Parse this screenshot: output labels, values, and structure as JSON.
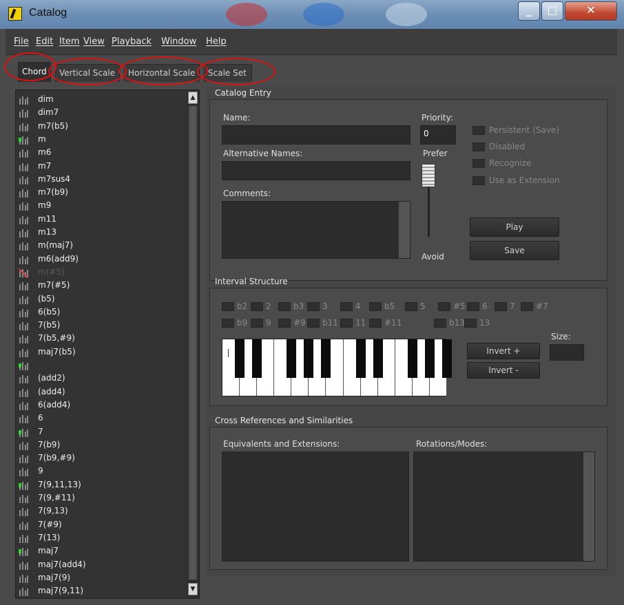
{
  "window": {
    "title": "Catalog"
  },
  "menu": [
    {
      "label": "File"
    },
    {
      "label": "Edit"
    },
    {
      "label": "Item"
    },
    {
      "label": "View"
    },
    {
      "label": "Playback"
    },
    {
      "label": "Window"
    },
    {
      "label": "Help"
    }
  ],
  "tabs": [
    {
      "label": "Chord",
      "active": true
    },
    {
      "label": "Vertical Scale",
      "active": false
    },
    {
      "label": "Horizontal Scale",
      "active": false
    },
    {
      "label": "Scale Set",
      "active": false
    }
  ],
  "chord_list": [
    {
      "label": "dim",
      "marker": false,
      "disabled": false
    },
    {
      "label": "dim7",
      "marker": false,
      "disabled": false
    },
    {
      "label": "m7(b5)",
      "marker": false,
      "disabled": false
    },
    {
      "label": "m",
      "marker": true,
      "disabled": false
    },
    {
      "label": "m6",
      "marker": false,
      "disabled": false
    },
    {
      "label": "m7",
      "marker": false,
      "disabled": false
    },
    {
      "label": "m7sus4",
      "marker": false,
      "disabled": false
    },
    {
      "label": "m7(b9)",
      "marker": false,
      "disabled": false
    },
    {
      "label": "m9",
      "marker": false,
      "disabled": false
    },
    {
      "label": "m11",
      "marker": false,
      "disabled": false
    },
    {
      "label": "m13",
      "marker": false,
      "disabled": false
    },
    {
      "label": "m(maj7)",
      "marker": false,
      "disabled": false
    },
    {
      "label": "m6(add9)",
      "marker": false,
      "disabled": false
    },
    {
      "label": "m(#5)",
      "marker": false,
      "disabled": true
    },
    {
      "label": "m7(#5)",
      "marker": false,
      "disabled": false
    },
    {
      "label": "(b5)",
      "marker": false,
      "disabled": false
    },
    {
      "label": "6(b5)",
      "marker": false,
      "disabled": false
    },
    {
      "label": "7(b5)",
      "marker": false,
      "disabled": false
    },
    {
      "label": "7(b5,#9)",
      "marker": false,
      "disabled": false
    },
    {
      "label": "maj7(b5)",
      "marker": false,
      "disabled": false
    },
    {
      "label": "",
      "marker": true,
      "disabled": false
    },
    {
      "label": "(add2)",
      "marker": false,
      "disabled": false
    },
    {
      "label": "(add4)",
      "marker": false,
      "disabled": false
    },
    {
      "label": "6(add4)",
      "marker": false,
      "disabled": false
    },
    {
      "label": "6",
      "marker": false,
      "disabled": false
    },
    {
      "label": "7",
      "marker": true,
      "disabled": false
    },
    {
      "label": "7(b9)",
      "marker": false,
      "disabled": false
    },
    {
      "label": "7(b9,#9)",
      "marker": false,
      "disabled": false
    },
    {
      "label": "9",
      "marker": false,
      "disabled": false
    },
    {
      "label": "7(9,11,13)",
      "marker": true,
      "disabled": false
    },
    {
      "label": "7(9,#11)",
      "marker": false,
      "disabled": false
    },
    {
      "label": "7(9,13)",
      "marker": false,
      "disabled": false
    },
    {
      "label": "7(#9)",
      "marker": false,
      "disabled": false
    },
    {
      "label": "7(13)",
      "marker": false,
      "disabled": false
    },
    {
      "label": "maj7",
      "marker": true,
      "disabled": false
    },
    {
      "label": "maj7(add4)",
      "marker": false,
      "disabled": false
    },
    {
      "label": "maj7(9)",
      "marker": false,
      "disabled": false
    },
    {
      "label": "maj7(9,11)",
      "marker": false,
      "disabled": false
    }
  ],
  "catalog_entry": {
    "group_title": "Catalog Entry",
    "name_label": "Name:",
    "name_value": "",
    "alt_names_label": "Alternative Names:",
    "alt_names_value": "",
    "comments_label": "Comments:",
    "priority_label": "Priority:",
    "priority_value": "0",
    "prefer_label": "Prefer",
    "avoid_label": "Avoid",
    "checks": [
      {
        "label": "Persistent (Save)",
        "checked": false
      },
      {
        "label": "Disabled",
        "checked": false
      },
      {
        "label": "Recognize",
        "checked": false
      },
      {
        "label": "Use as Extension",
        "checked": false
      }
    ],
    "play_label": "Play",
    "save_label": "Save"
  },
  "interval_structure": {
    "group_title": "Interval Structure",
    "row1": [
      "b2",
      "2",
      "b3",
      "3",
      "4",
      "b5",
      "5",
      "#5",
      "6",
      "7",
      "#7"
    ],
    "row2": [
      "b9",
      "9",
      "#9",
      "b11",
      "11",
      "#11",
      "b13",
      "13"
    ],
    "invert_plus": "Invert +",
    "invert_minus": "Invert -",
    "size_label": "Size:",
    "size_value": ""
  },
  "cross_refs": {
    "group_title": "Cross References and Similarities",
    "equivalents_label": "Equivalents and Extensions:",
    "rotations_label": "Rotations/Modes:"
  }
}
